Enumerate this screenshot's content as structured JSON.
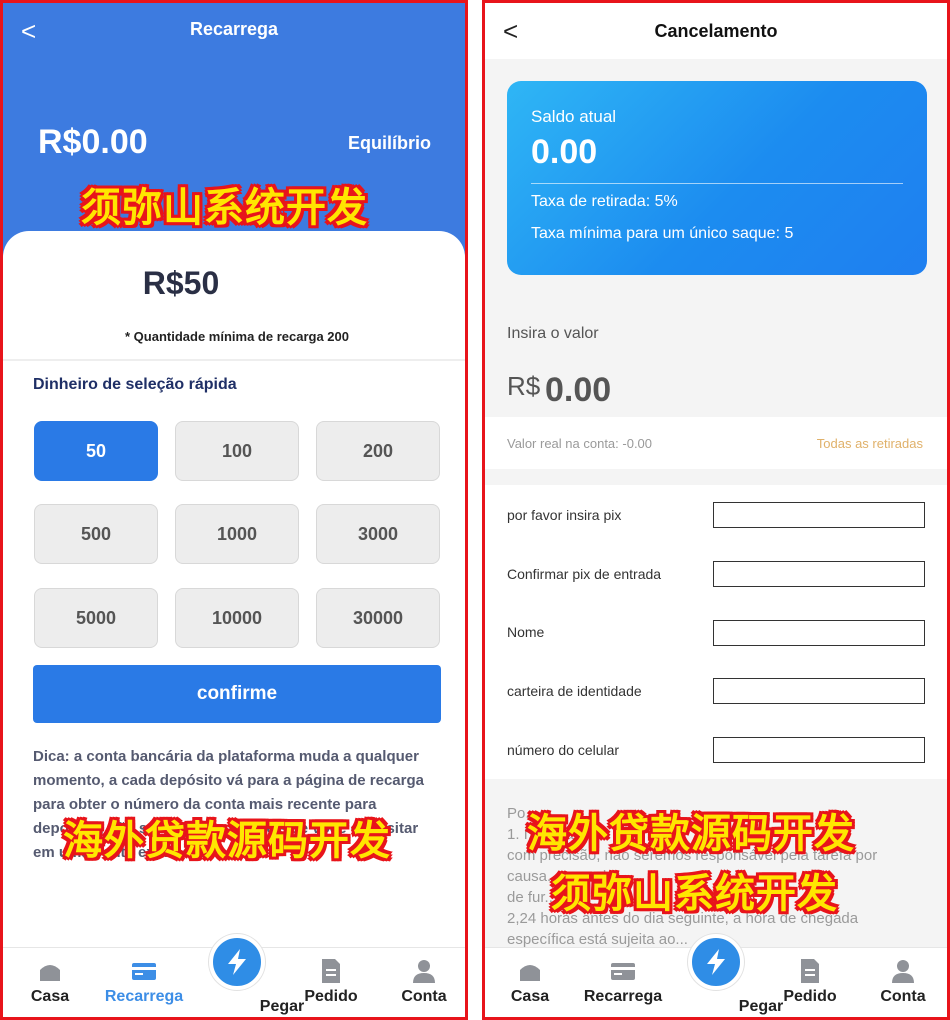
{
  "left": {
    "title": "Recarrega",
    "back_glyph": "<",
    "balance": "R$0.00",
    "balance_label": "Equilíbrio",
    "watermark_top": "须弥山系统开发",
    "selected_amount": "R$50",
    "min_note": "* Quantidade mínima de recarga 200",
    "quick_title": "Dinheiro de seleção rápida",
    "amounts": [
      "50",
      "100",
      "200",
      "500",
      "1000",
      "3000",
      "5000",
      "10000",
      "30000"
    ],
    "confirm_label": "confirme",
    "tip": "Dica: a conta bancária da plataforma muda a qualquer momento, a cada depósito vá para a página de recarga para obter o número da conta mais recente para depositar, não somos responsáveis se você depositar em uma conta expirada!",
    "watermark_bottom": "海外贷款源码开发"
  },
  "right": {
    "title": "Cancelamento",
    "back_glyph": "<",
    "card": {
      "label": "Saldo atual",
      "value": "0.00",
      "fee": "Taxa de retirada: 5%",
      "min": "Taxa mínima para um único saque: 5"
    },
    "amount_label": "Insira o valor",
    "currency": "R$",
    "amount_value": "0.00",
    "real_value": "Valor real na conta: -0.00",
    "all_withdrawals": "Todas as retiradas",
    "form": [
      {
        "label": "por favor insira pix",
        "value": ""
      },
      {
        "label": "Confirmar pix de entrada",
        "value": ""
      },
      {
        "label": "Nome",
        "value": ""
      },
      {
        "label": "carteira de identidade",
        "value": ""
      },
      {
        "label": "número do celular",
        "value": ""
      }
    ],
    "notes": [
      "Po...",
      "1. I... ...ria",
      "com precisão, não seremos responsável pela tarefa por",
      "causa... ...perda",
      "de fur...",
      "2,24 horas antes do dia seguinte, a hora de chegada",
      "específica está sujeita ao..."
    ],
    "watermark_1": "海外贷款源码开发",
    "watermark_2": "须弥山系统开发"
  },
  "tabs": [
    {
      "label": "Casa",
      "icon": "home-icon"
    },
    {
      "label": "Recarrega",
      "icon": "card-icon"
    },
    {
      "label": "Pegar",
      "icon": "lightning-icon"
    },
    {
      "label": "Pedido",
      "icon": "document-icon"
    },
    {
      "label": "Conta",
      "icon": "user-icon"
    }
  ],
  "colors": {
    "primary": "#2a7ae6",
    "header_blue": "#3d7be0",
    "active_tab": "#3d8ee6",
    "frame_red": "#e8141b",
    "watermark_yellow": "#ffe600",
    "gold_link": "#e0b16a"
  }
}
